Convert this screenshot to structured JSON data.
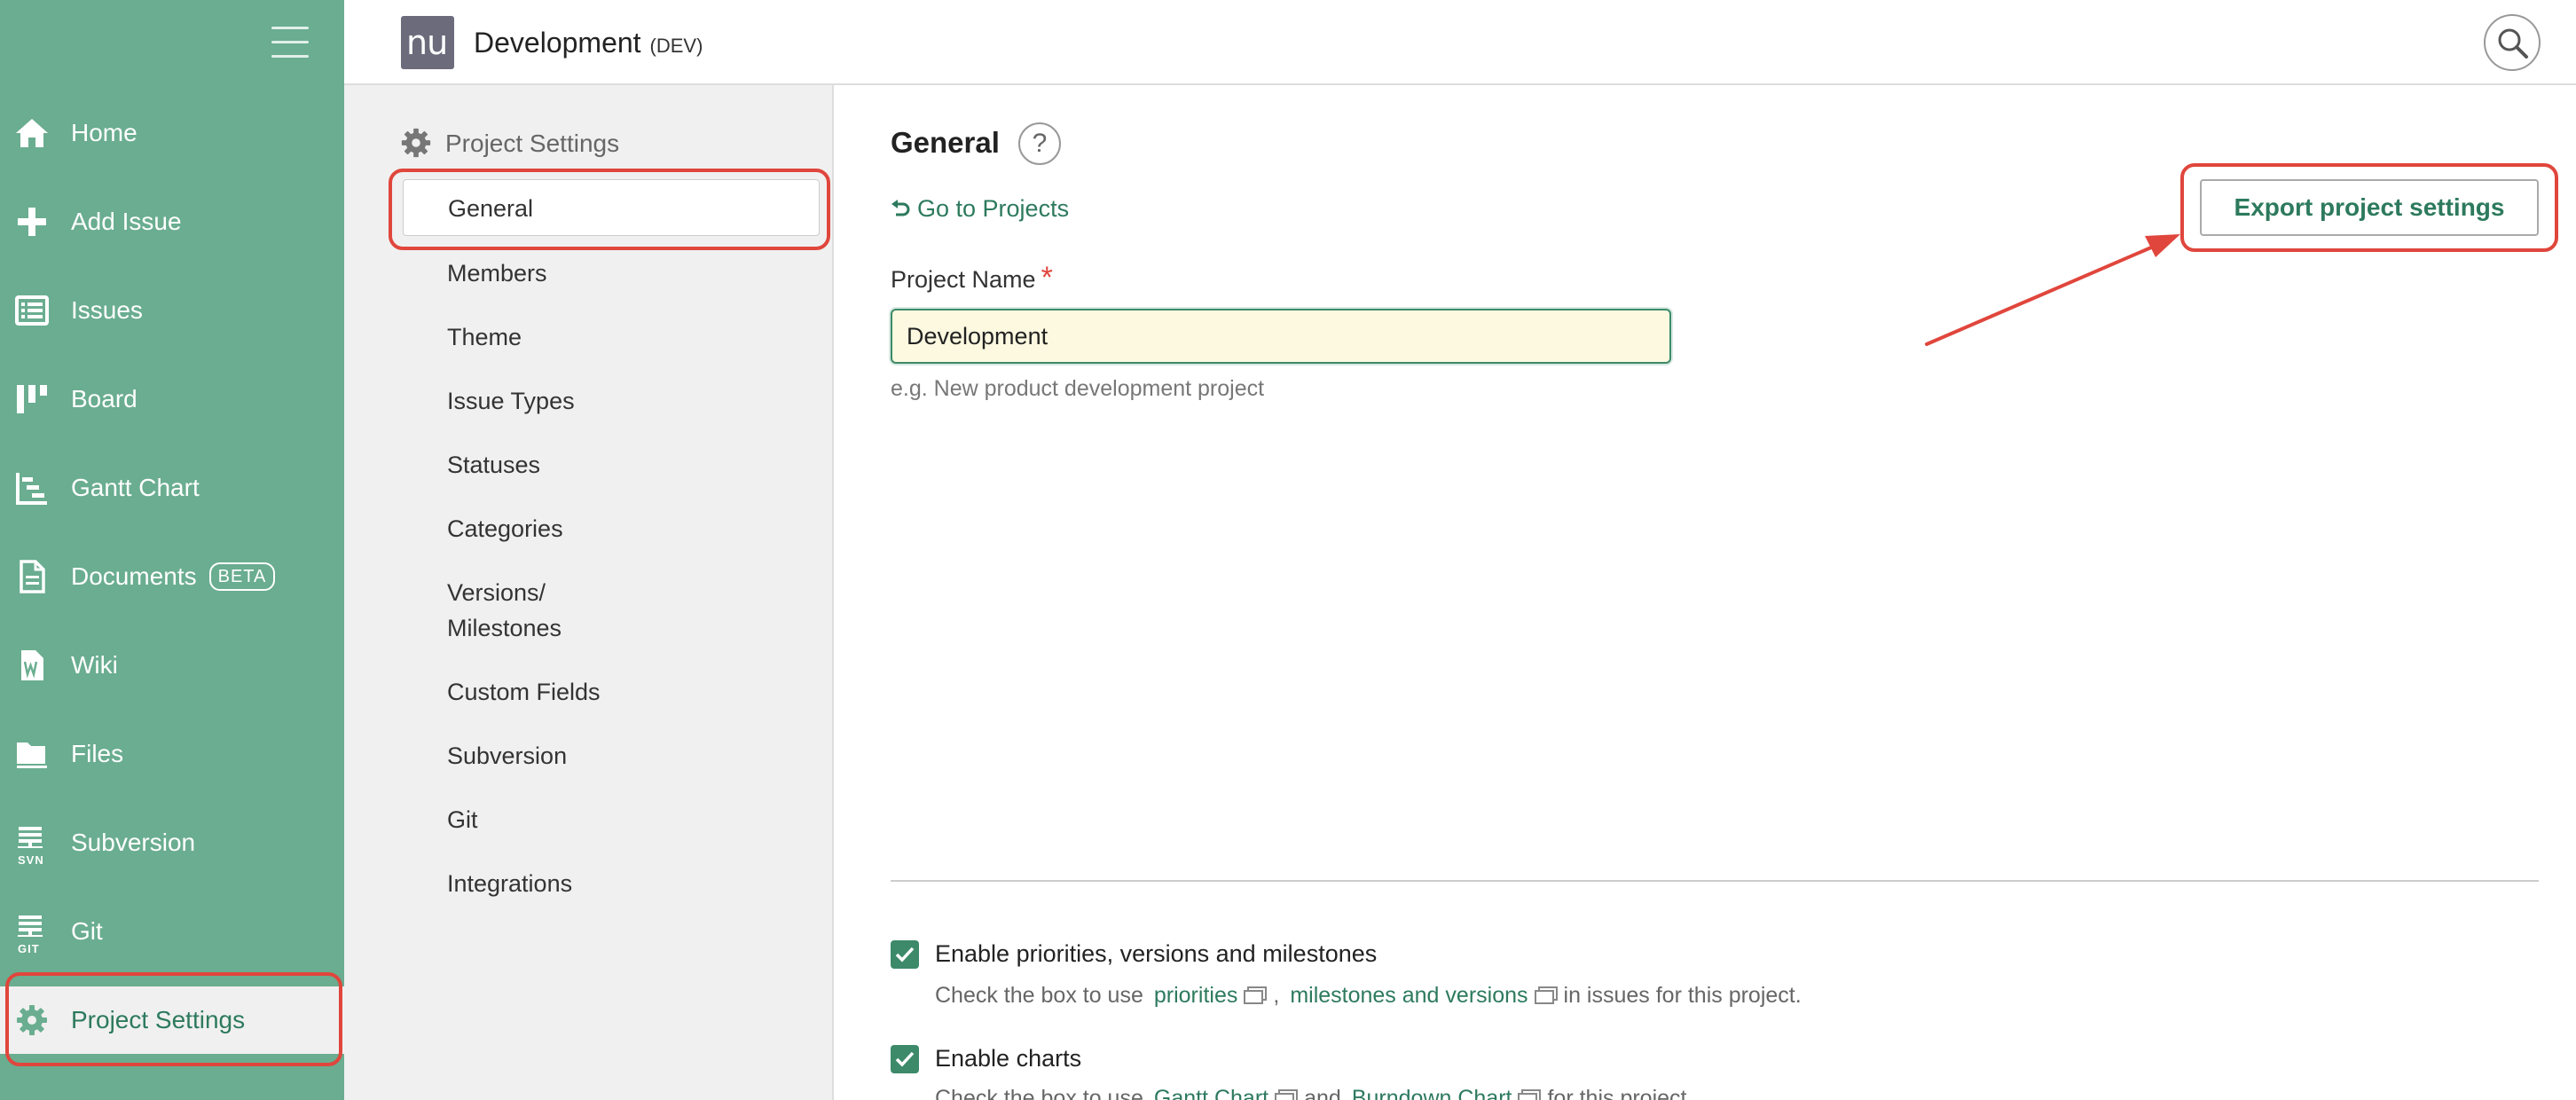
{
  "nav": {
    "items": [
      {
        "label": "Home",
        "icon": "home-icon"
      },
      {
        "label": "Add Issue",
        "icon": "plus-icon"
      },
      {
        "label": "Issues",
        "icon": "list-icon"
      },
      {
        "label": "Board",
        "icon": "board-icon"
      },
      {
        "label": "Gantt Chart",
        "icon": "gantt-icon"
      },
      {
        "label": "Documents",
        "icon": "document-icon",
        "badge": "BETA"
      },
      {
        "label": "Wiki",
        "icon": "wiki-icon"
      },
      {
        "label": "Files",
        "icon": "folder-icon"
      },
      {
        "label": "Subversion",
        "icon": "svn-icon",
        "icon_text": "SVN"
      },
      {
        "label": "Git",
        "icon": "git-icon",
        "icon_text": "GIT"
      },
      {
        "label": "Project Settings",
        "icon": "gear-icon",
        "active": true
      }
    ]
  },
  "header": {
    "logo_text": "nu",
    "project_name": "Development",
    "project_key": "(DEV)"
  },
  "settings_nav": {
    "heading": "Project Settings",
    "items": [
      "General",
      "Members",
      "Theme",
      "Issue Types",
      "Statuses",
      "Categories",
      "Versions/ Milestones",
      "Custom Fields",
      "Subversion",
      "Git",
      "Integrations"
    ],
    "selected": "General"
  },
  "main": {
    "title": "General",
    "help": "?",
    "back_link": "Go to Projects",
    "export_button": "Export project settings",
    "project_name_label": "Project Name",
    "required_mark": "*",
    "project_name_value": "Development",
    "project_name_help": "e.g. New product development project",
    "options": [
      {
        "label": "Enable priorities, versions and milestones",
        "checked": true,
        "help_prefix": "Check the box to use",
        "link1": "priorities",
        "separator": ",",
        "link2": "milestones and versions",
        "help_suffix": "in issues for this project."
      },
      {
        "label": "Enable charts",
        "checked": true,
        "help_prefix": "Check the box to use",
        "link1": "Gantt Chart",
        "separator": "and",
        "link2": "Burndown Chart",
        "help_suffix": "for this project."
      }
    ]
  },
  "colors": {
    "sidebar": "#6aad90",
    "accent": "#2d7a5e",
    "annotation": "#e0463c",
    "input_bg": "#fcf9e0"
  }
}
